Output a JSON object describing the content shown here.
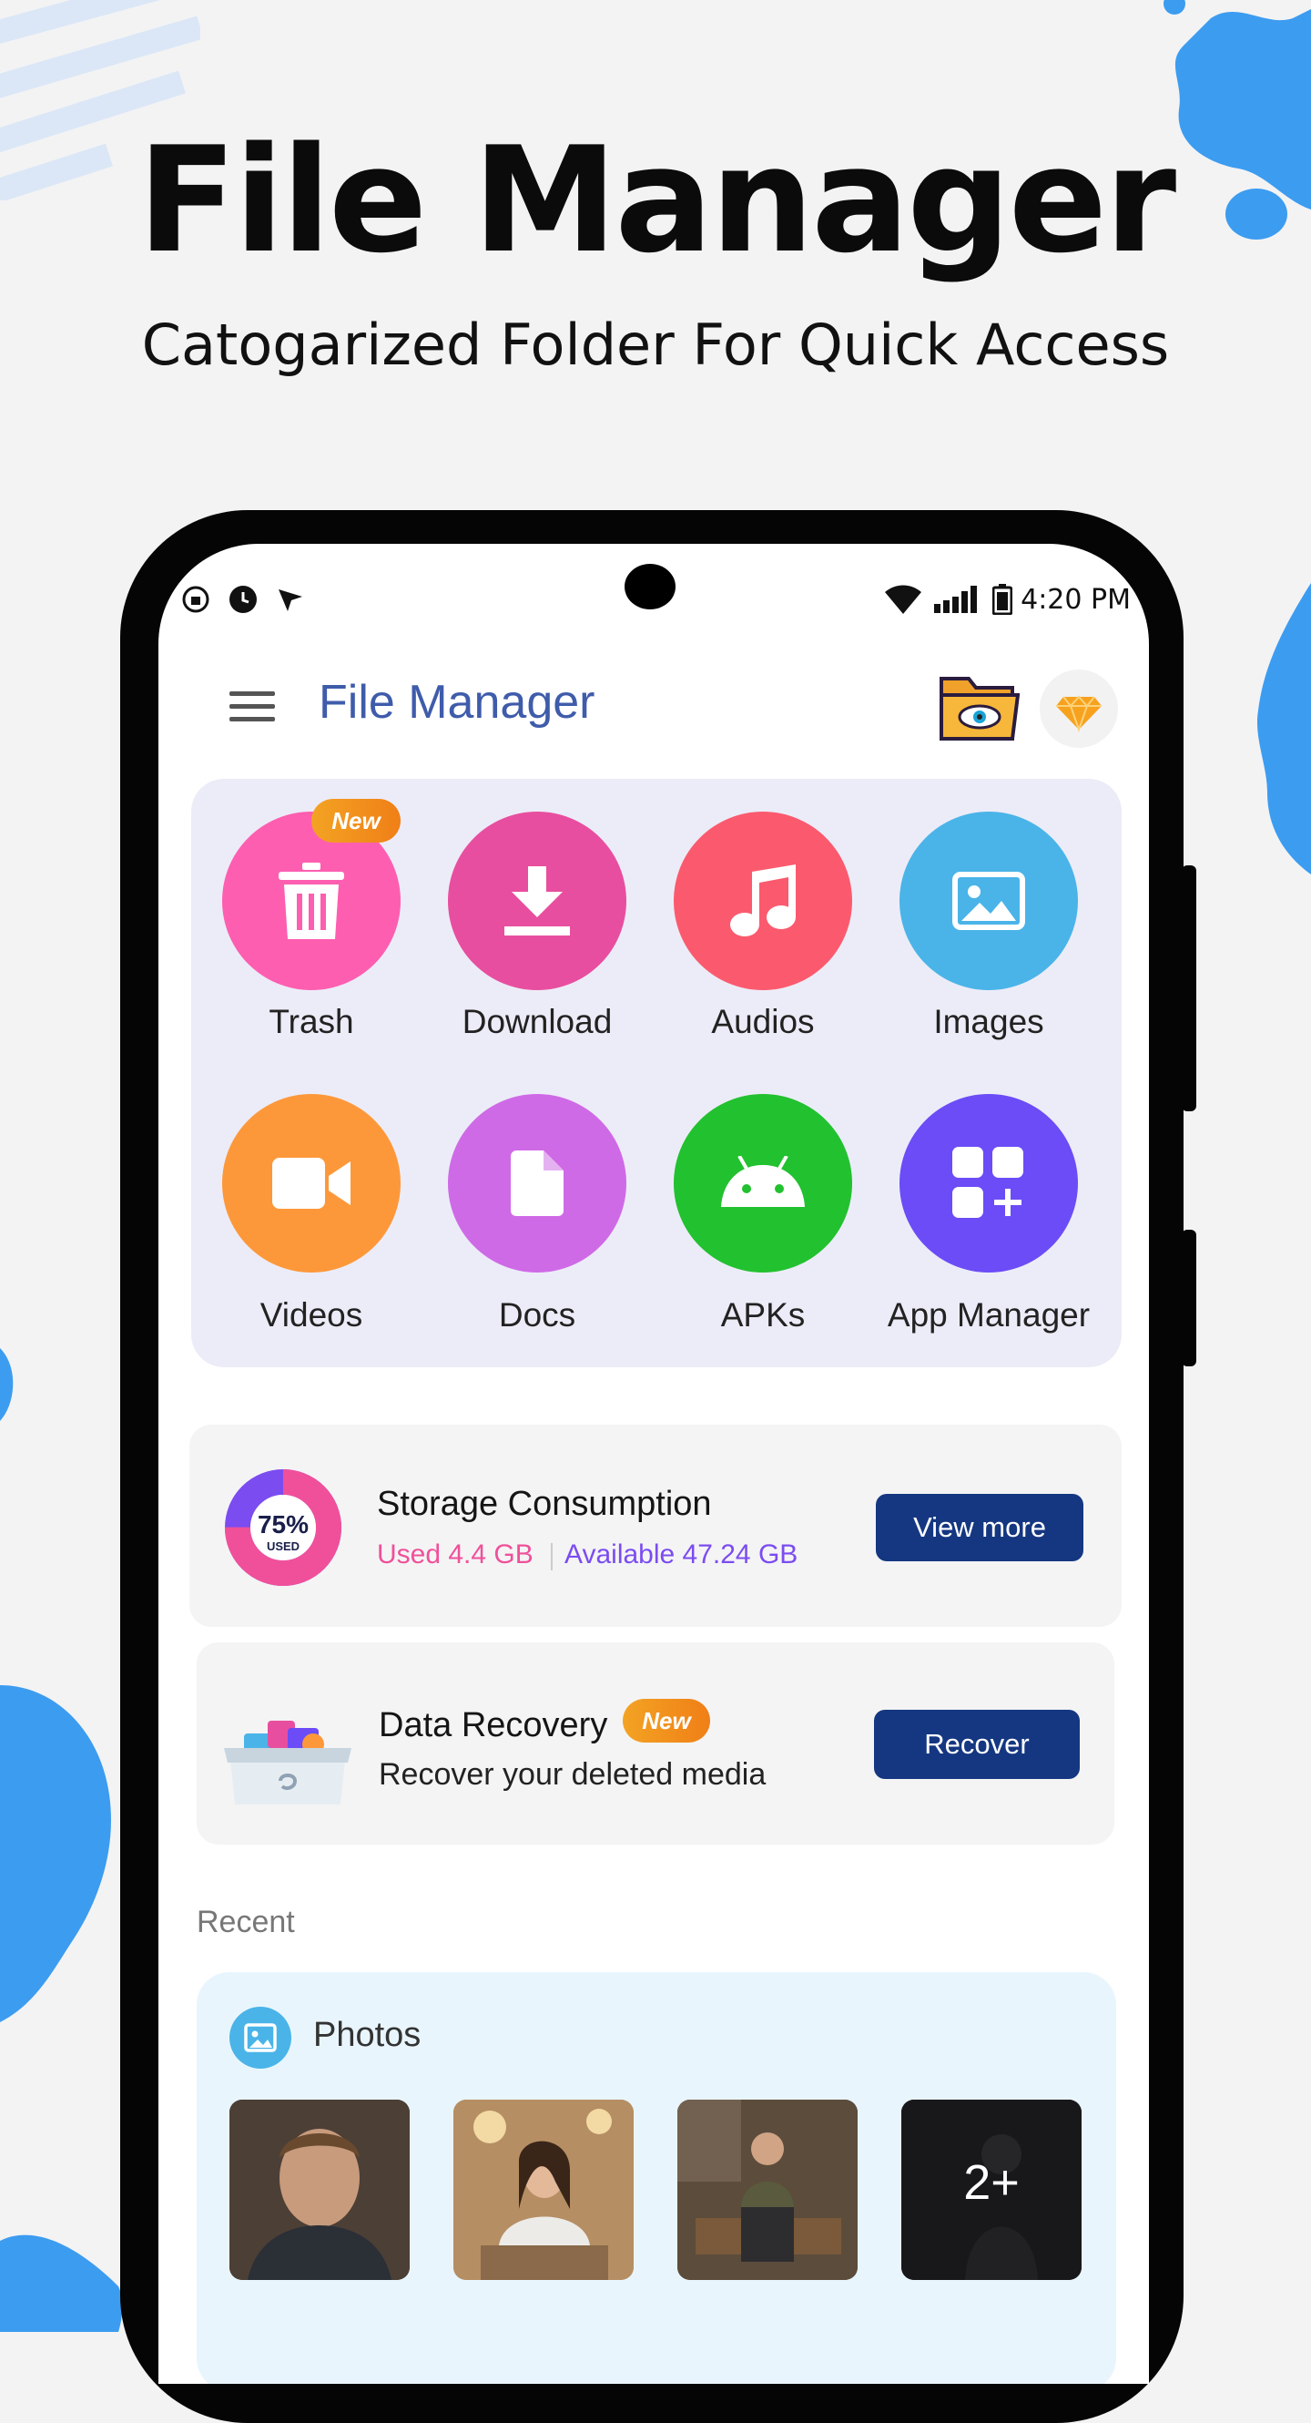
{
  "promo": {
    "title": "File Manager",
    "subtitle": "Catogarized Folder For Quick Access"
  },
  "status_bar": {
    "time": "4:20 PM"
  },
  "app_bar": {
    "title": "File Manager"
  },
  "categories": [
    {
      "label": "Trash",
      "icon": "trash-icon",
      "color": "#fd5eb0",
      "badge": "New"
    },
    {
      "label": "Download",
      "icon": "download-icon",
      "color": "#e84e9f"
    },
    {
      "label": "Audios",
      "icon": "music-note-icon",
      "color": "#fb5a6e"
    },
    {
      "label": "Images",
      "icon": "image-icon",
      "color": "#4ab4e8"
    },
    {
      "label": "Videos",
      "icon": "video-camera-icon",
      "color": "#fd983a"
    },
    {
      "label": "Docs",
      "icon": "document-icon",
      "color": "#cf6ae6"
    },
    {
      "label": "APKs",
      "icon": "android-icon",
      "color": "#22c12f"
    },
    {
      "label": "App Manager",
      "icon": "app-grid-icon",
      "color": "#6b4cf6"
    }
  ],
  "storage": {
    "title": "Storage Consumption",
    "percent": "75%",
    "percent_caption": "USED",
    "used": "Used 4.4 GB",
    "available": "Available 47.24 GB",
    "button": "View more",
    "used_fraction": 0.75,
    "used_color": "#f0509a",
    "available_color": "#7b4cf0"
  },
  "recovery": {
    "title": "Data Recovery",
    "badge": "New",
    "subtitle": "Recover your deleted media",
    "button": "Recover"
  },
  "recent": {
    "label": "Recent",
    "section": "Photos",
    "more_count": "2+"
  },
  "colors": {
    "brand": "#3f5cab",
    "button": "#153781",
    "badge": "#f3a323"
  }
}
